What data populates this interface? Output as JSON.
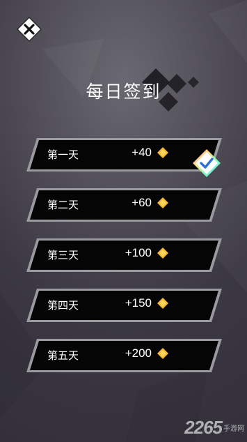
{
  "title": "每日签到",
  "close_icon": "close-icon",
  "days": [
    {
      "label": "第一天",
      "reward": "+40",
      "icon": "diamond-gem-icon",
      "claimed": true
    },
    {
      "label": "第二天",
      "reward": "+60",
      "icon": "diamond-gem-icon",
      "claimed": false
    },
    {
      "label": "第三天",
      "reward": "+100",
      "icon": "diamond-gem-icon",
      "claimed": false
    },
    {
      "label": "第四天",
      "reward": "+150",
      "icon": "diamond-gem-icon",
      "claimed": false
    },
    {
      "label": "第五天",
      "reward": "+200",
      "icon": "diamond-gem-icon",
      "claimed": false
    }
  ],
  "watermark": {
    "number": "2265",
    "text": "手游网"
  },
  "colors": {
    "gem": "#f5b830",
    "row_fill": "#050505",
    "row_border": "#b9b9bd",
    "check": "#2f6fd8"
  }
}
